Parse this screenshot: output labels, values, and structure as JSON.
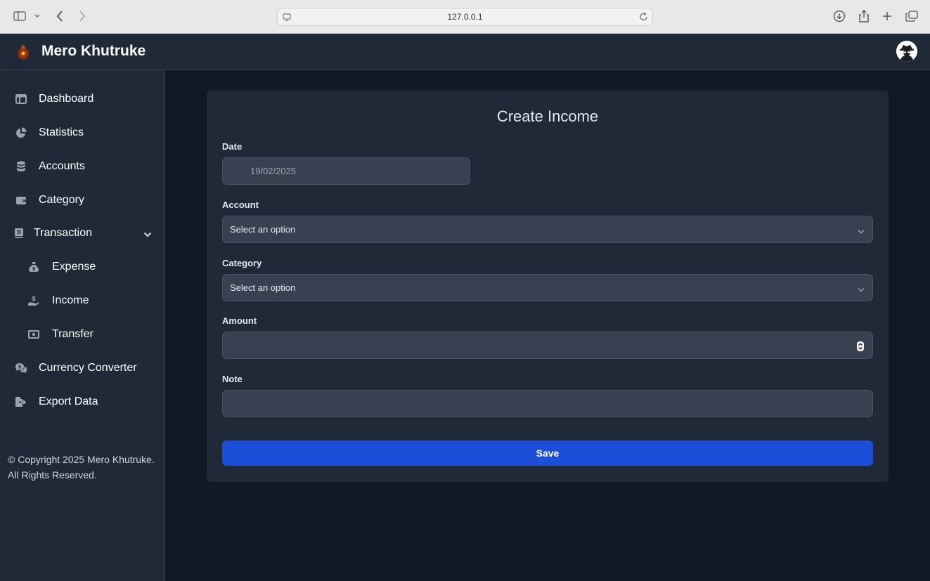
{
  "browser": {
    "url": "127.0.0.1"
  },
  "header": {
    "brand": "Mero Khutruke"
  },
  "sidebar": {
    "items": [
      {
        "label": "Dashboard",
        "icon": "table-columns-icon"
      },
      {
        "label": "Statistics",
        "icon": "pie-chart-icon"
      },
      {
        "label": "Accounts",
        "icon": "database-icon"
      },
      {
        "label": "Category",
        "icon": "wallet-icon"
      },
      {
        "label": "Transaction",
        "icon": "book-icon"
      },
      {
        "label": "Expense",
        "icon": "money-bag-icon"
      },
      {
        "label": "Income",
        "icon": "hand-dollar-icon"
      },
      {
        "label": "Transfer",
        "icon": "money-bill-transfer-icon"
      },
      {
        "label": "Currency Converter",
        "icon": "comments-dollar-icon"
      },
      {
        "label": "Export Data",
        "icon": "file-export-icon"
      }
    ],
    "copyright": "© Copyright 2025 Mero Khutruke. All Rights Reserved."
  },
  "form": {
    "title": "Create Income",
    "date_label": "Date",
    "date_value": "19/02/2025",
    "account_label": "Account",
    "account_value": "Select an option",
    "category_label": "Category",
    "category_value": "Select an option",
    "amount_label": "Amount",
    "amount_value": "",
    "note_label": "Note",
    "note_value": "",
    "save_label": "Save"
  },
  "colors": {
    "page_bg": "#111827",
    "panel_bg": "#1f2937",
    "input_bg": "#374151",
    "primary": "#1d4ed8"
  }
}
